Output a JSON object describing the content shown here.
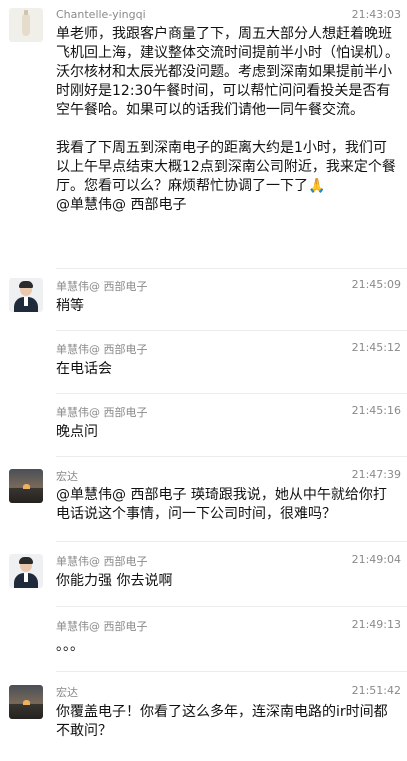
{
  "messages": [
    {
      "sender": "Chantelle-yingqi",
      "time": "21:43:03",
      "avatar": "cup-photo-avatar",
      "text": "单老师，我跟客户商量了下，周五大部分人想赶着晚班飞机回上海，建议整体交流时间提前半小时（怕误机）。沃尔核材和太辰光都没问题。考虑到深南如果提前半小时刚好是12:30午餐时间，可以帮忙问问看投关是否有空午餐哈。如果可以的话我们请他一同午餐交流。\n\n我看了下周五到深南电子的距离大约是1小时，我们可以上午早点结束大概12点到深南公司附近，我来定个餐厅。您看可以么？麻烦帮忙协调了一下了🙏\n@单慧伟@ 西部电子"
    },
    {
      "sender": "单慧伟@ 西部电子",
      "time": "21:45:09",
      "avatar": "man-in-suit-avatar",
      "text": "稍等"
    },
    {
      "sender": "单慧伟@ 西部电子",
      "time": "21:45:12",
      "avatar": "",
      "text": "在电话会"
    },
    {
      "sender": "单慧伟@ 西部电子",
      "time": "21:45:16",
      "avatar": "",
      "text": "晚点问"
    },
    {
      "sender": "宏达",
      "time": "21:47:39",
      "avatar": "sunset-landscape-avatar",
      "text": "@单慧伟@ 西部电子 瑛琦跟我说，她从中午就给你打电话说这个事情，问一下公司时间，很难吗？"
    },
    {
      "sender": "单慧伟@ 西部电子",
      "time": "21:49:04",
      "avatar": "man-in-suit-avatar",
      "text": "你能力强 你去说啊"
    },
    {
      "sender": "单慧伟@ 西部电子",
      "time": "21:49:13",
      "avatar": "",
      "text": "。。。"
    },
    {
      "sender": "宏达",
      "time": "21:51:42",
      "avatar": "sunset-landscape-avatar",
      "text": "你覆盖电子！你看了这么多年，连深南电路的ir时间都不敢问？"
    }
  ]
}
